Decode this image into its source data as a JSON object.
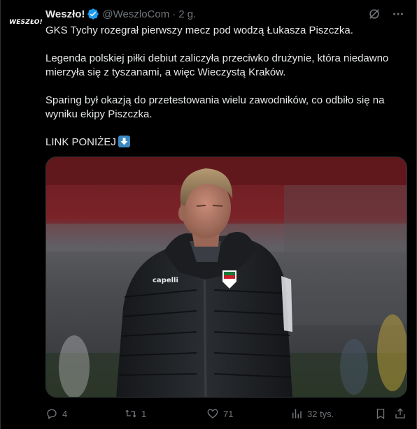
{
  "tweet": {
    "author": {
      "name": "Weszło!",
      "handle": "@WeszloCom",
      "avatar_text": "WESZŁO!",
      "verified": true
    },
    "separator": "·",
    "time": "2 g.",
    "paragraphs": [
      "GKS Tychy rozegrał pierwszy mecz pod wodzą Łukasza Piszczka.",
      "Legenda polskiej piłki debiut zaliczyła przeciwko drużynie, która niedawno mierzyła się z tyszanami, a więc Wieczystą Kraków.",
      "Sparing był okazją do przetestowania wielu zawodników, co odbiło się na wyniku ekipy Piszczka."
    ],
    "link_line": "LINK PONIŻEJ",
    "media": {
      "jacket_logo": "capelli"
    },
    "stats": {
      "replies": "4",
      "retweets": "1",
      "likes": "71",
      "views": "32 tys."
    },
    "icons": {
      "verified": "verified-badge-icon",
      "grok": "grok-icon",
      "more": "more-icon",
      "reply": "reply-icon",
      "retweet": "retweet-icon",
      "like": "heart-icon",
      "views": "views-icon",
      "bookmark": "bookmark-icon",
      "share": "share-icon",
      "link_emoji": "down-arrow-emoji-icon"
    },
    "colors": {
      "background": "#000000",
      "text": "#e7e9ea",
      "secondary": "#71767b",
      "verified": "#1d9bf0"
    }
  }
}
